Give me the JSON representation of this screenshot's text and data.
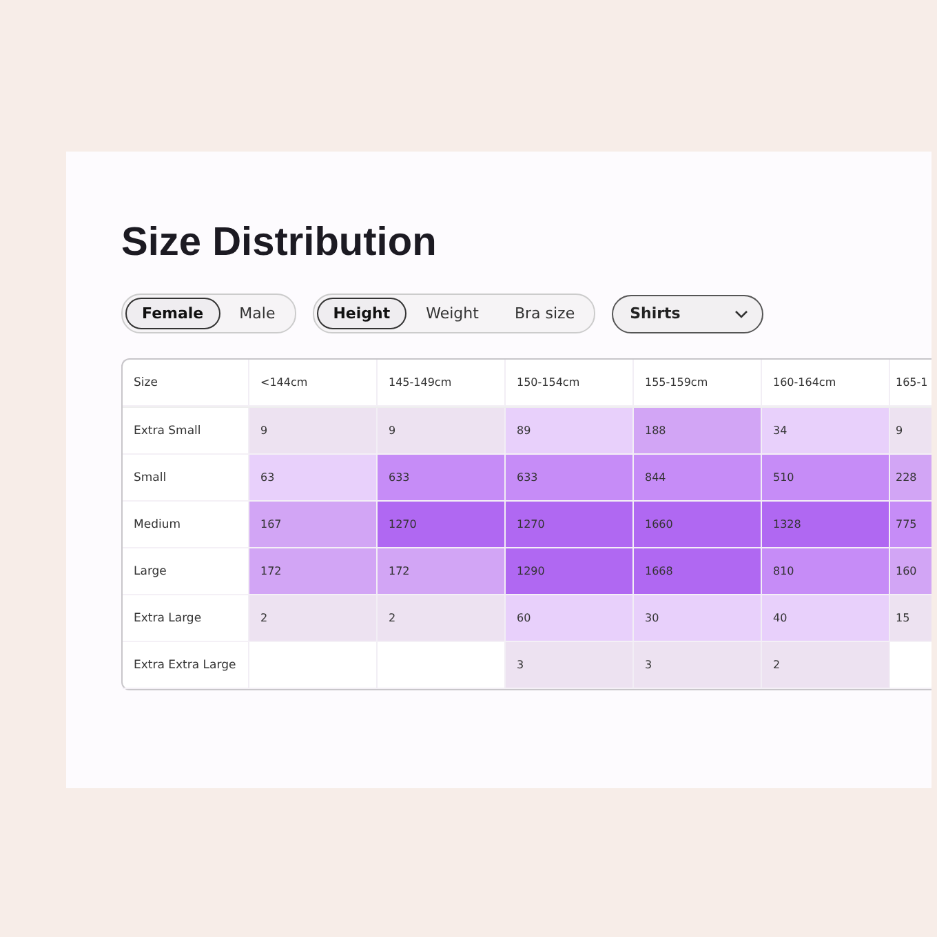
{
  "title": "Size Distribution",
  "gender_toggle": [
    {
      "label": "Female",
      "selected": true
    },
    {
      "label": "Male",
      "selected": false
    }
  ],
  "measure_toggle": [
    {
      "label": "Height",
      "selected": true
    },
    {
      "label": "Weight",
      "selected": false
    },
    {
      "label": "Bra size",
      "selected": false
    }
  ],
  "category_dropdown": {
    "value": "Shirts"
  },
  "table": {
    "columns": [
      "Size",
      "<144cm",
      "145-149cm",
      "150-154cm",
      "155-159cm",
      "160-164cm",
      "165-1"
    ],
    "rows": [
      {
        "cells": [
          {
            "text": "Extra Small"
          },
          {
            "text": "9",
            "color": "#ede2f1"
          },
          {
            "text": "9",
            "color": "#ede2f1"
          },
          {
            "text": "89",
            "color": "#e8d0fb"
          },
          {
            "text": "188",
            "color": "#d2a5f5"
          },
          {
            "text": "34",
            "color": "#e8d0fb"
          },
          {
            "text": "9",
            "color": "#ede2f1"
          }
        ]
      },
      {
        "cells": [
          {
            "text": "Small"
          },
          {
            "text": "63",
            "color": "#e8d0fb"
          },
          {
            "text": "633",
            "color": "#c68cf7"
          },
          {
            "text": "633",
            "color": "#c68cf7"
          },
          {
            "text": "844",
            "color": "#c68cf7"
          },
          {
            "text": "510",
            "color": "#c68cf7"
          },
          {
            "text": "228",
            "color": "#d2a5f5"
          }
        ]
      },
      {
        "cells": [
          {
            "text": "Medium"
          },
          {
            "text": "167",
            "color": "#d2a5f5"
          },
          {
            "text": "1270",
            "color": "#b068f2"
          },
          {
            "text": "1270",
            "color": "#b068f2"
          },
          {
            "text": "1660",
            "color": "#b068f2"
          },
          {
            "text": "1328",
            "color": "#b068f2"
          },
          {
            "text": "775",
            "color": "#c68cf7"
          }
        ]
      },
      {
        "cells": [
          {
            "text": "Large"
          },
          {
            "text": "172",
            "color": "#d2a5f5"
          },
          {
            "text": "172",
            "color": "#d2a5f5"
          },
          {
            "text": "1290",
            "color": "#b068f2"
          },
          {
            "text": "1668",
            "color": "#b068f2"
          },
          {
            "text": "810",
            "color": "#c68cf7"
          },
          {
            "text": "160",
            "color": "#d2a5f5"
          }
        ]
      },
      {
        "cells": [
          {
            "text": "Extra Large"
          },
          {
            "text": "2",
            "color": "#ede2f1"
          },
          {
            "text": "2",
            "color": "#ede2f1"
          },
          {
            "text": "60",
            "color": "#e8d0fb"
          },
          {
            "text": "30",
            "color": "#e8d0fb"
          },
          {
            "text": "40",
            "color": "#e8d0fb"
          },
          {
            "text": "15",
            "color": "#ede2f1"
          }
        ]
      },
      {
        "cells": [
          {
            "text": "Extra Extra Large"
          },
          {
            "text": "",
            "color": "#ffffff"
          },
          {
            "text": "",
            "color": "#ffffff"
          },
          {
            "text": "3",
            "color": "#ede2f1"
          },
          {
            "text": "3",
            "color": "#ede2f1"
          },
          {
            "text": "2",
            "color": "#ede2f1"
          },
          {
            "text": "",
            "color": "#ffffff"
          }
        ]
      }
    ]
  }
}
